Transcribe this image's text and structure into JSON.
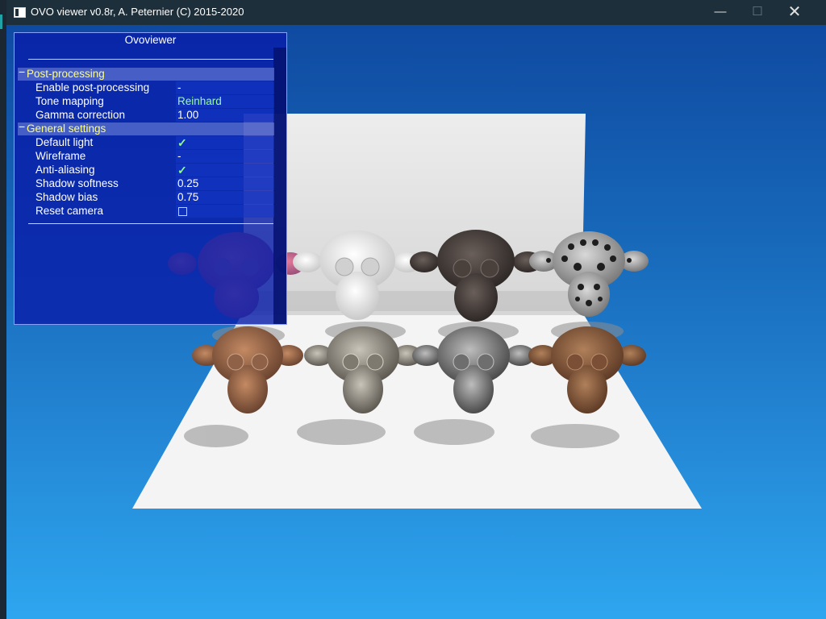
{
  "window": {
    "title": "OVO viewer v0.8r, A. Peternier (C) 2015-2020",
    "controls": {
      "minimize": "—",
      "maximize": "☐",
      "close": "✕"
    }
  },
  "panel": {
    "title": "Ovoviewer",
    "sections": [
      {
        "toggle": "−",
        "label": "Post-processing",
        "rows": [
          {
            "label": "Enable post-processing",
            "value": "-"
          },
          {
            "label": "Tone mapping",
            "value": "Reinhard"
          },
          {
            "label": "Gamma correction",
            "value": "1.00"
          }
        ]
      },
      {
        "toggle": "−",
        "label": "General settings",
        "rows": [
          {
            "label": "Default light",
            "value": "✓"
          },
          {
            "label": "Wireframe",
            "value": "-"
          },
          {
            "label": "Anti-aliasing",
            "value": "✓"
          },
          {
            "label": "Shadow softness",
            "value": "0.25"
          },
          {
            "label": "Shadow bias",
            "value": "0.75"
          },
          {
            "label": "Reset camera",
            "value": ""
          }
        ]
      }
    ]
  },
  "scene": {
    "models": [
      "pink",
      "white",
      "dark-metal",
      "perforated-metal",
      "rust",
      "stone",
      "steel",
      "copper"
    ]
  },
  "colors": {
    "titlebar": "#1d2f3a",
    "panel_bg": "#0a20aa",
    "section_label": "#ffff80",
    "value_green": "#9aff9a",
    "sky_top": "#0f4aa1",
    "sky_bottom": "#2ea6ef"
  }
}
